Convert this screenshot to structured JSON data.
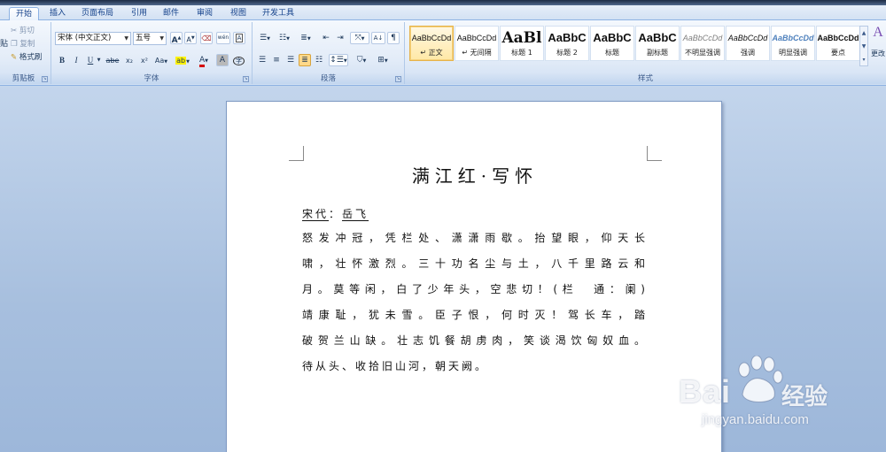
{
  "ribbon_tabs": [
    "开始",
    "插入",
    "页面布局",
    "引用",
    "邮件",
    "审阅",
    "视图",
    "开发工具"
  ],
  "clipboard": {
    "paste_label": "贴",
    "cut_label": "剪切",
    "copy_label": "复制",
    "format_painter_label": "格式刷",
    "group_label": "剪贴板"
  },
  "font": {
    "font_name": "宋体 (中文正文)",
    "font_size": "五号",
    "grow_label": "A",
    "shrink_label": "A",
    "wen": "wén",
    "bold": "B",
    "italic": "I",
    "underline": "U",
    "strike": "abe",
    "subscript": "x₂",
    "superscript": "x²",
    "change_case": "Aa",
    "highlight": "ab",
    "font_color": "A",
    "char_shade": "A",
    "enclose": "字",
    "group_label": "字体"
  },
  "paragraph": {
    "group_label": "段落"
  },
  "styles": {
    "group_label": "样式",
    "change_label": "更改",
    "change_icon_letter": "A",
    "tiles": [
      {
        "sample": "AaBbCcDd",
        "name": "↵ 正文",
        "selected": true
      },
      {
        "sample": "AaBbCcDd",
        "name": "↵ 无间隔",
        "selected": false
      },
      {
        "sample": "AaBl",
        "name": "标题 1",
        "selected": false
      },
      {
        "sample": "AaBbC",
        "name": "标题 2",
        "selected": false
      },
      {
        "sample": "AaBbC",
        "name": "标题",
        "selected": false
      },
      {
        "sample": "AaBbC",
        "name": "副标题",
        "selected": false
      },
      {
        "sample": "AaBbCcDd",
        "name": "不明显强调",
        "selected": false
      },
      {
        "sample": "AaBbCcDd",
        "name": "强调",
        "selected": false
      },
      {
        "sample": "AaBbCcDd",
        "name": "明显强调",
        "selected": false
      },
      {
        "sample": "AaBbCcDd",
        "name": "要点",
        "selected": false
      }
    ]
  },
  "document": {
    "title": "满江红·写怀",
    "author_dynasty": "宋代",
    "author_sep": "：",
    "author_name": "岳飞",
    "lines": [
      "怒发冲冠，凭栏处、潇潇雨歇。抬望眼，仰天长",
      "啸，壮怀激烈。三十功名尘与土，八千里路云和",
      "月。莫等闲，白了少年头，空悲切！(栏　通：阑)",
      "靖康耻，犹未雪。臣子恨，何时灭！驾长车，踏",
      "破贺兰山缺。壮志饥餐胡虏肉，笑谈渴饮匈奴血。",
      "待从头、收拾旧山河，朝天阙。"
    ]
  },
  "watermark": {
    "brand": "Bai",
    "brand2": "经验",
    "url": "jingyan.baidu.com"
  },
  "colors": {
    "ribbon_bg": "#dfe9f5",
    "workspace_bg": "#a9c0de",
    "accent": "#15428b",
    "selected_style": "#ffe8a6"
  }
}
